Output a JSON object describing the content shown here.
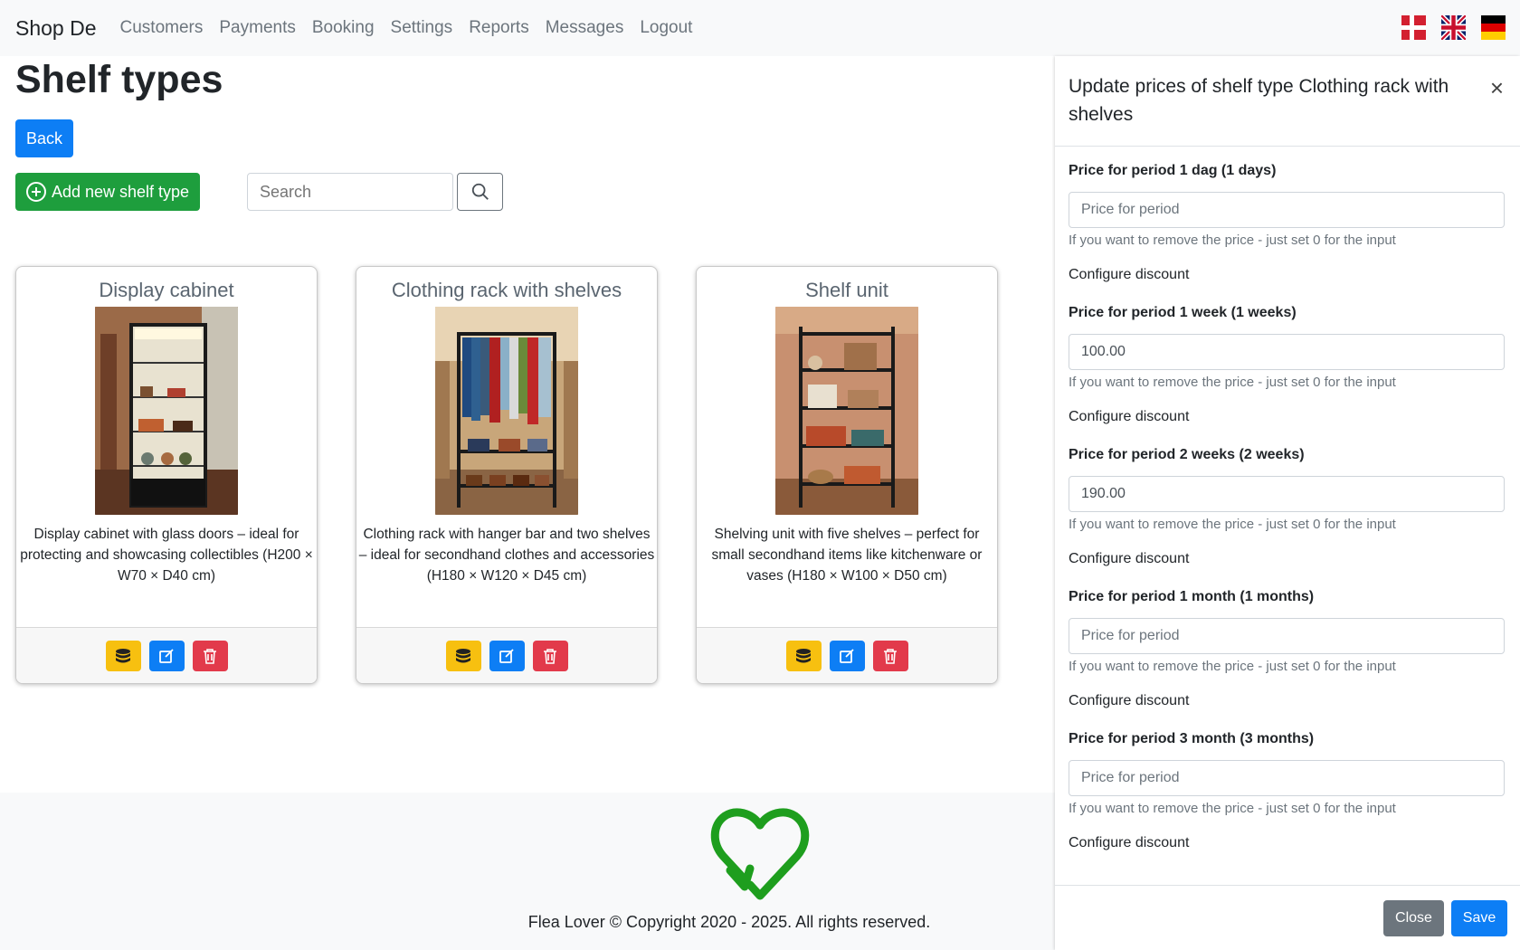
{
  "navbar": {
    "brand": "Shop De",
    "links": [
      "Customers",
      "Payments",
      "Booking",
      "Settings",
      "Reports",
      "Messages",
      "Logout"
    ],
    "flags": [
      "danish-flag-icon",
      "uk-flag-icon",
      "german-flag-icon"
    ]
  },
  "page": {
    "title": "Shelf types",
    "back_label": "Back",
    "add_label": "Add new shelf type",
    "search_placeholder": "Search"
  },
  "cards": [
    {
      "title": "Display cabinet",
      "description": "Display cabinet with glass doors – ideal for protecting and showcasing collectibles (H200 × W70 × D40 cm)"
    },
    {
      "title": "Clothing rack with shelves",
      "description": "Clothing rack with hanger bar and two shelves – ideal for secondhand clothes and accessories (H180 × W120 × D45 cm)"
    },
    {
      "title": "Shelf unit",
      "description": "Shelving unit with five shelves – perfect for small secondhand items like kitchenware or vases (H180 × W100 × D50 cm)"
    }
  ],
  "footer": {
    "copyright": "Flea Lover © Copyright 2020 - 2025. All rights reserved."
  },
  "panel": {
    "title": "Update prices of shelf type Clothing rack with shelves",
    "placeholder": "Price for period",
    "hint": "If you want to remove the price - just set 0 for the input",
    "discount_label": "Configure discount",
    "fields": [
      {
        "label": "Price for period 1 dag (1 days)",
        "value": ""
      },
      {
        "label": "Price for period 1 week (1 weeks)",
        "value": "100.00"
      },
      {
        "label": "Price for period 2 weeks (2 weeks)",
        "value": "190.00"
      },
      {
        "label": "Price for period 1 month (1 months)",
        "value": ""
      },
      {
        "label": "Price for period 3 month (3 months)",
        "value": ""
      }
    ],
    "close_label": "Close",
    "save_label": "Save"
  },
  "colors": {
    "primary": "#0d7ef5",
    "success": "#1e9e3d",
    "warning": "#f7c010",
    "danger": "#e23a4b",
    "secondary": "#6c757d",
    "logo": "#1e9e1e"
  }
}
